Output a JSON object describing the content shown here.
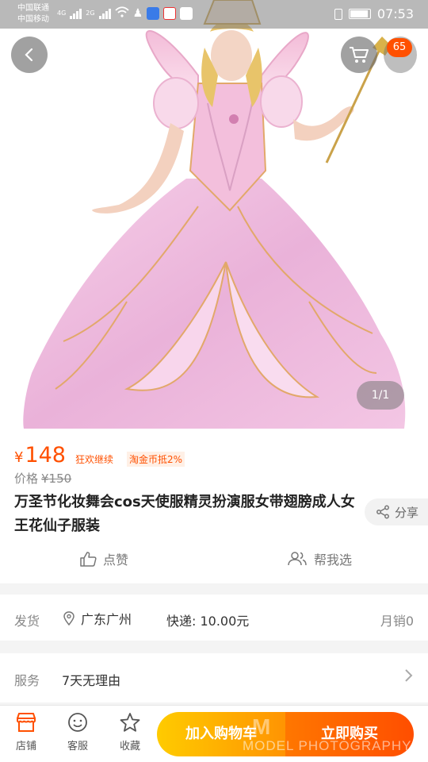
{
  "status_bar": {
    "carrier_1": "中国联通",
    "carrier_2": "中国移动",
    "net_1": "4G",
    "net_2": "2G",
    "time": "07:53"
  },
  "top_nav": {
    "cart_badge": "65"
  },
  "gallery": {
    "counter": "1/1"
  },
  "product": {
    "currency": "¥",
    "price": "148",
    "promo_tag": "狂欢继续",
    "coin_tag": "淘金币抵2%",
    "original_label": "价格",
    "original_price": "¥150",
    "title": "万圣节化妆舞会cos天使服精灵扮演服女带翅膀成人女王花仙子服装",
    "share_label": "分享",
    "like_label": "点赞",
    "help_choose_label": "帮我选"
  },
  "shipping": {
    "label": "发货",
    "location": "广东广州",
    "fee": "快递: 10.00元",
    "monthly_sales": "月销0"
  },
  "service": {
    "label": "服务",
    "value": "7天无理由"
  },
  "bottom_bar": {
    "store_label": "店铺",
    "support_label": "客服",
    "favorite_label": "收藏",
    "add_to_cart_label": "加入购物车",
    "buy_now_label": "立即购买"
  },
  "watermark": {
    "mark": "M",
    "text": "MODEL PHOTOGRAPHY"
  },
  "colors": {
    "accent": "#ff5000",
    "cart_gradient": [
      "#ffcb00",
      "#ff9402"
    ],
    "buy_gradient": [
      "#ff7700",
      "#ff4e00"
    ]
  }
}
